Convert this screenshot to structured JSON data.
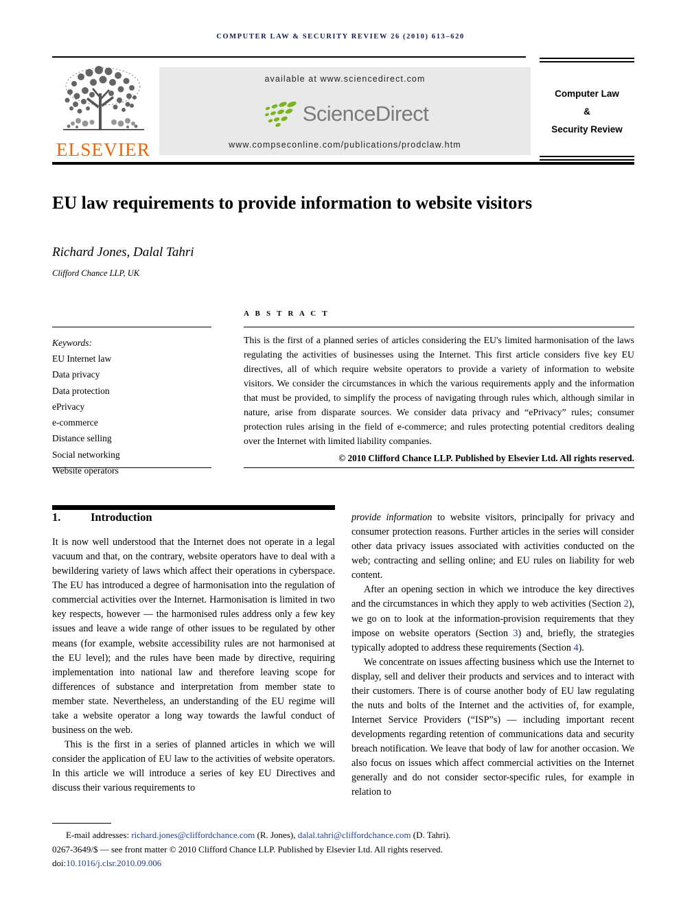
{
  "running_head": "Computer law & security review 26 (2010) 613–620",
  "masthead": {
    "publisher_name": "ELSEVIER",
    "publisher_logo_icon": "elsevier-tree-icon",
    "available_at": "available at www.sciencedirect.com",
    "sciencedirect_wordmark": "ScienceDirect",
    "sciencedirect_logo_icon": "sciencedirect-leaves-icon",
    "journal_url": "www.compseconline.com/publications/prodclaw.htm",
    "journal_box": {
      "line1": "Computer Law",
      "line2": "&",
      "line3": "Security Review"
    },
    "colors": {
      "elsevier_orange": "#eb6608",
      "band_gray": "#e9e9e9",
      "sciencedirect_green": "#7ab51d",
      "sciencedirect_gray": "#7a7a7a",
      "running_head_navy": "#0d1a57",
      "link_blue": "#1f3f94"
    }
  },
  "article": {
    "title": "EU law requirements to provide information to website visitors",
    "authors": "Richard Jones, Dalal Tahri",
    "affiliation": "Clifford Chance LLP, UK"
  },
  "keywords": {
    "heading": "Keywords:",
    "items": [
      "EU Internet law",
      "Data privacy",
      "Data protection",
      "ePrivacy",
      "e-commerce",
      "Distance selling",
      "Social networking",
      "Website operators"
    ]
  },
  "abstract": {
    "label": "A B S T R A C T",
    "text": "This is the first of a planned series of articles considering the EU's limited harmonisation of the laws regulating the activities of businesses using the Internet. This first article considers five key EU directives, all of which require website operators to provide a variety of information to website visitors. We consider the circumstances in which the various requirements apply and the information that must be provided, to simplify the process of navigating through rules which, although similar in nature, arise from disparate sources. We consider data privacy and “ePrivacy” rules; consumer protection rules arising in the field of e-commerce; and rules protecting potential creditors dealing over the Internet with limited liability companies.",
    "copyright": "© 2010 Clifford Chance LLP. Published by Elsevier Ltd. All rights reserved."
  },
  "body": {
    "section_number": "1.",
    "section_title": "Introduction",
    "left_paragraph_1": "It is now well understood that the Internet does not operate in a legal vacuum and that, on the contrary, website operators have to deal with a bewildering variety of laws which affect their operations in cyberspace. The EU has introduced a degree of harmonisation into the regulation of commercial activities over the Internet. Harmonisation is limited in two key respects, however — the harmonised rules address only a few key issues and leave a wide range of other issues to be regulated by other means (for example, website accessibility rules are not harmonised at the EU level); and the rules have been made by directive, requiring implementation into national law and therefore leaving scope for differences of substance and interpretation from member state to member state. Nevertheless, an understanding of the EU regime will take a website operator a long way towards the lawful conduct of business on the web.",
    "left_paragraph_2": "This is the first in a series of planned articles in which we will consider the application of EU law to the activities of website operators. In this article we will introduce a series of key EU Directives and discuss their various requirements to",
    "right_paragraph_1_italic": "provide information",
    "right_paragraph_1_rest": " to website visitors, principally for privacy and consumer protection reasons. Further articles in the series will consider other data privacy issues associated with activities conducted on the web; contracting and selling online; and EU rules on liability for web content.",
    "right_paragraph_2_a": "After an opening section in which we introduce the key directives and the circumstances in which they apply to web activities (Section ",
    "right_xref_2": "2",
    "right_paragraph_2_b": "), we go on to look at the information-provision requirements that they impose on website operators (Section ",
    "right_xref_3": "3",
    "right_paragraph_2_c": ") and, briefly, the strategies typically adopted to address these requirements (Section ",
    "right_xref_4": "4",
    "right_paragraph_2_d": ").",
    "right_paragraph_3": "We concentrate on issues affecting business which use the Internet to display, sell and deliver their products and services and to interact with their customers. There is of course another body of EU law regulating the nuts and bolts of the Internet and the activities of, for example, Internet Service Providers (“ISP”s) — including important recent developments regarding retention of communications data and security breach notification. We leave that body of law for another occasion. We also focus on issues which affect commercial activities on the Internet generally and do not consider sector-specific rules, for example in relation to"
  },
  "footnote": {
    "email_label": "E-mail addresses:",
    "email_1": "richard.jones@cliffordchance.com",
    "email_1_attr": "(R. Jones),",
    "email_2": "dalal.tahri@cliffordchance.com",
    "email_2_attr": "(D. Tahri).",
    "issn_line": "0267-3649/$ — see front matter © 2010 Clifford Chance LLP. Published by Elsevier Ltd. All rights reserved.",
    "doi_label": "doi:",
    "doi_value": "10.1016/j.clsr.2010.09.006"
  }
}
